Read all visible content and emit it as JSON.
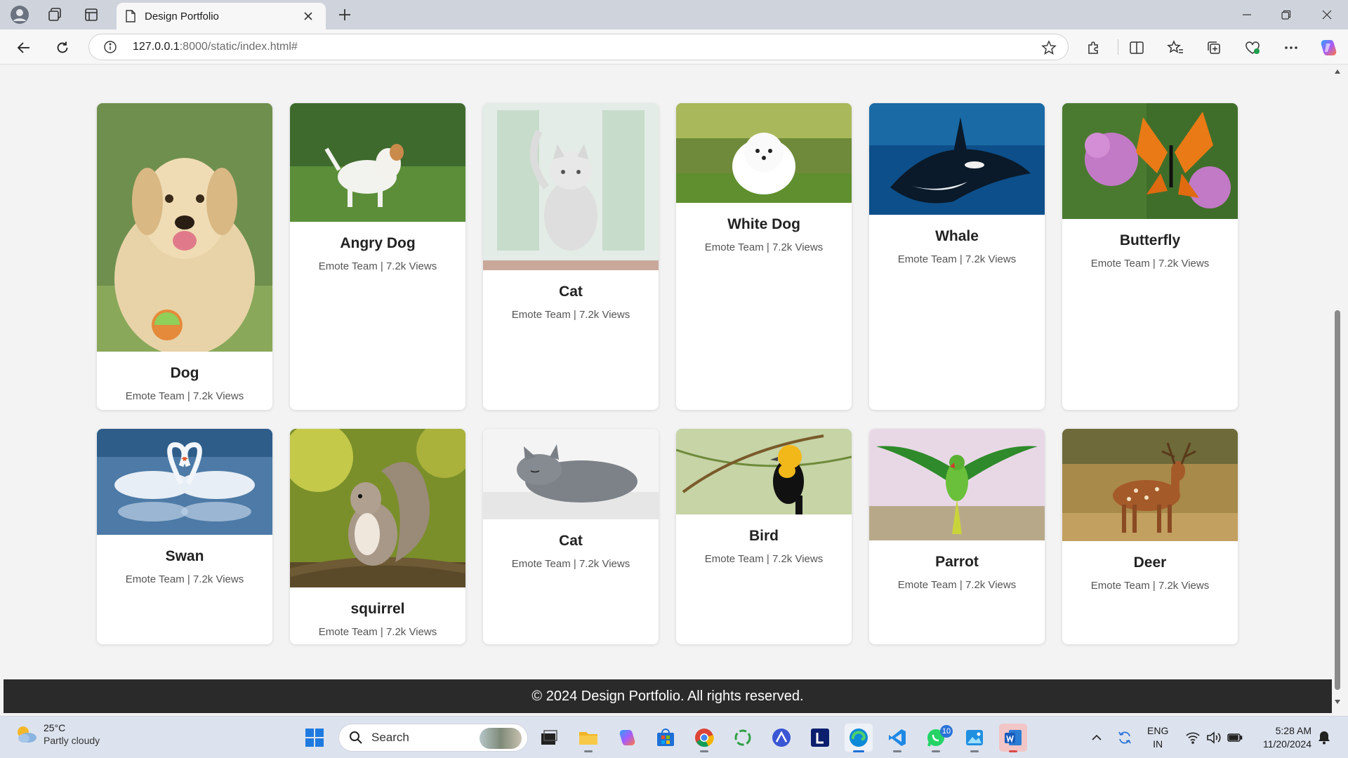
{
  "browser": {
    "tab_title": "Design Portfolio",
    "url_host": "127.0.0.1",
    "url_path": ":8000/static/index.html#"
  },
  "page": {
    "cards": [
      {
        "title": "Dog",
        "meta": "Emote Team | 7.2k Views",
        "image": "golden-retriever-photo"
      },
      {
        "title": "Angry Dog",
        "meta": "Emote Team | 7.2k Views",
        "image": "barking-terrier-photo"
      },
      {
        "title": "Cat",
        "meta": "Emote Team | 7.2k Views",
        "image": "white-cat-photo"
      },
      {
        "title": "White Dog",
        "meta": "Emote Team | 7.2k Views",
        "image": "white-pomeranian-photo"
      },
      {
        "title": "Whale",
        "meta": "Emote Team | 7.2k Views",
        "image": "orca-underwater-photo"
      },
      {
        "title": "Butterfly",
        "meta": "Emote Team | 7.2k Views",
        "image": "monarch-butterfly-photo"
      },
      {
        "title": "Swan",
        "meta": "Emote Team | 7.2k Views",
        "image": "swans-heart-photo"
      },
      {
        "title": "squirrel",
        "meta": "Emote Team | 7.2k Views",
        "image": "squirrel-photo"
      },
      {
        "title": "Cat",
        "meta": "Emote Team | 7.2k Views",
        "image": "sleeping-grey-cat-photo"
      },
      {
        "title": "Bird",
        "meta": "Emote Team | 7.2k Views",
        "image": "yellow-headed-blackbird-photo"
      },
      {
        "title": "Parrot",
        "meta": "Emote Team | 7.2k Views",
        "image": "flying-parrot-photo"
      },
      {
        "title": "Deer",
        "meta": "Emote Team | 7.2k Views",
        "image": "spotted-deer-photo"
      }
    ],
    "footer": "© 2024 Design Portfolio. All rights reserved."
  },
  "taskbar": {
    "weather_temp": "25°C",
    "weather_desc": "Partly cloudy",
    "search_label": "Search",
    "whatsapp_badge": "10",
    "lang_line1": "ENG",
    "lang_line2": "IN",
    "time": "5:28 AM",
    "date": "11/20/2024"
  },
  "colors": {
    "footer_bg": "#2a2a2a",
    "page_bg": "#f3f3f3",
    "accent": "#2b73d8"
  }
}
